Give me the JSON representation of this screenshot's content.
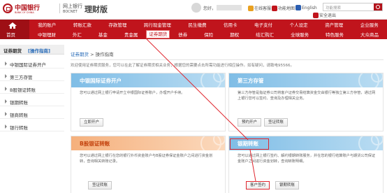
{
  "header": {
    "bank_name": "中国银行",
    "bank_name_en": "BANK OF CHINA",
    "netbank": "网上银行",
    "netbank_en": "BOCNET",
    "product": "理财版",
    "greeting": "您好，",
    "links": [
      {
        "label": "在线客服",
        "icon": "chat-icon",
        "color": "#e8a020"
      },
      {
        "label": "功能地图",
        "icon": "map-icon",
        "color": "#c0141c"
      },
      {
        "label": "English",
        "icon": "flag-icon",
        "color": "#2a5db0"
      },
      {
        "label": "安全退出",
        "icon": "power-icon",
        "color": "#c0141c"
      }
    ],
    "search_placeholder": "功能搜索"
  },
  "nav": {
    "home_label": "首页",
    "row1": [
      "我的账户",
      "转账汇款",
      "存款管理",
      "跨行现金管理",
      "民生缴费",
      "信用卡",
      "电子支付",
      "个人设定",
      "资产管理",
      "企业服务"
    ],
    "row2": [
      "中银理财",
      "外汇",
      "基金",
      "贵金属",
      "证券期货",
      "债券",
      "保险",
      "期权",
      "结汇购汇",
      "全球服务",
      "特色服务",
      "大众商品"
    ],
    "active_item": "证券期货"
  },
  "sidebar": {
    "title": "证券期货",
    "guide": "[操作指南]",
    "items": [
      "中银国际证券开户",
      "第三方存管",
      "B股银证转账",
      "银期转账",
      "银商转账",
      "银行转账"
    ]
  },
  "main": {
    "breadcrumb_link": "证券期货",
    "breadcrumb_sep": " > ",
    "breadcrumb_current": "操作指南",
    "intro": "欢迎使用证券期货服务，您可以在此了解证券期货相关业务，根据您的需要点击所需功能进行相应操作。如有疑问，请致电95566。",
    "cards": [
      {
        "title": "中银国际证券开户",
        "desc": "您可以通过网上银行申请开立中银国际证券账户，办理开户手续。",
        "buttons": [
          "立即开户"
        ]
      },
      {
        "title": "第三方存管",
        "desc": "第三方存管是指证券公司将客户证券交易结算资金交由银行等独立第三方存管，通过网上银行您可以签约、查询及办理相关业务。",
        "buttons": [
          "预约开户",
          "签证转账"
        ]
      },
      {
        "title": "B股银证转账",
        "desc": "您可以通过网上银行在您的银行外币资金账户与B股证券保证金账户之间进行资金划转，查询相关转账记录。",
        "buttons": [
          "签证转账"
        ]
      },
      {
        "title": "银期转账",
        "desc": "您可以通过网上银行签约、解约银期转账服务，并在您的银行结算账户与期货公司保证金账户之间进行资金划转，查询转账明细。",
        "buttons": [
          "客户签约",
          "银期转账"
        ]
      }
    ]
  },
  "colors": {
    "brand_red": "#c0141c",
    "highlight_red": "#e0262e",
    "link_blue": "#2a6cb8"
  }
}
